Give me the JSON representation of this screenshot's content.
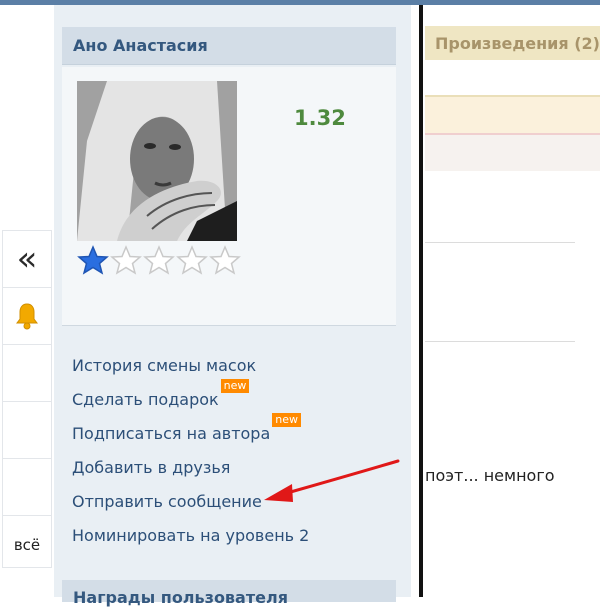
{
  "profile": {
    "name": "Ано Анастасия",
    "rating": "1.32",
    "stars_filled": 1,
    "stars_total": 5
  },
  "menu": [
    {
      "label": "История смены масок",
      "badge": ""
    },
    {
      "label": "Сделать подарок",
      "badge": "new"
    },
    {
      "label": "Подписаться на автора",
      "badge": "new"
    },
    {
      "label": "Добавить в друзья",
      "badge": ""
    },
    {
      "label": "Отправить сообщение",
      "badge": ""
    },
    {
      "label": "Номинировать на уровень 2",
      "badge": ""
    }
  ],
  "awards_header": "Награды пользователя",
  "left_toolbar": {
    "collapse_icon": "double-chevron-left-icon",
    "bell_icon": "bell-icon",
    "all_label": "всё"
  },
  "works_tab": "Произведения (2)",
  "snippet": "поэт... немного",
  "colors": {
    "accent_blue": "#34587f",
    "rating_green": "#4e8a3e",
    "badge_orange": "#ff8a00",
    "arrow_red": "#e01818"
  }
}
